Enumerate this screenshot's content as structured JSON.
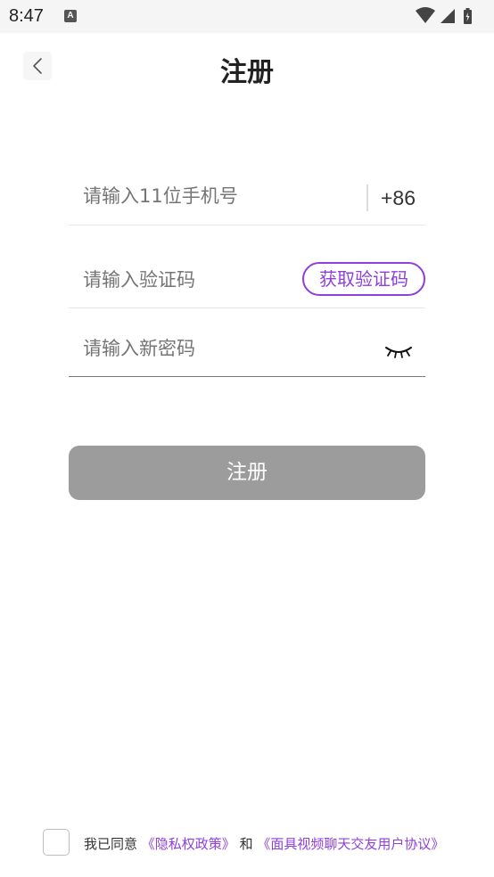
{
  "status_bar": {
    "time": "8:47",
    "notification_icon_letter": "A"
  },
  "header": {
    "title": "注册",
    "back_icon": "chevron-left-icon"
  },
  "form": {
    "phone": {
      "placeholder": "请输入11位手机号",
      "country_code": "+86"
    },
    "verification_code": {
      "placeholder": "请输入验证码",
      "get_code_label": "获取验证码"
    },
    "password": {
      "placeholder": "请输入新密码",
      "toggle_icon": "eye-closed-icon"
    },
    "submit_label": "注册"
  },
  "agreement": {
    "prefix": "我已同意",
    "privacy_link": "《隐私权政策》",
    "connector": "和",
    "terms_link": "《面具视频聊天交友用户协议》"
  },
  "colors": {
    "accent": "#8e3fdc",
    "button_disabled": "#9c9c9c",
    "placeholder": "#9a9a9a"
  }
}
